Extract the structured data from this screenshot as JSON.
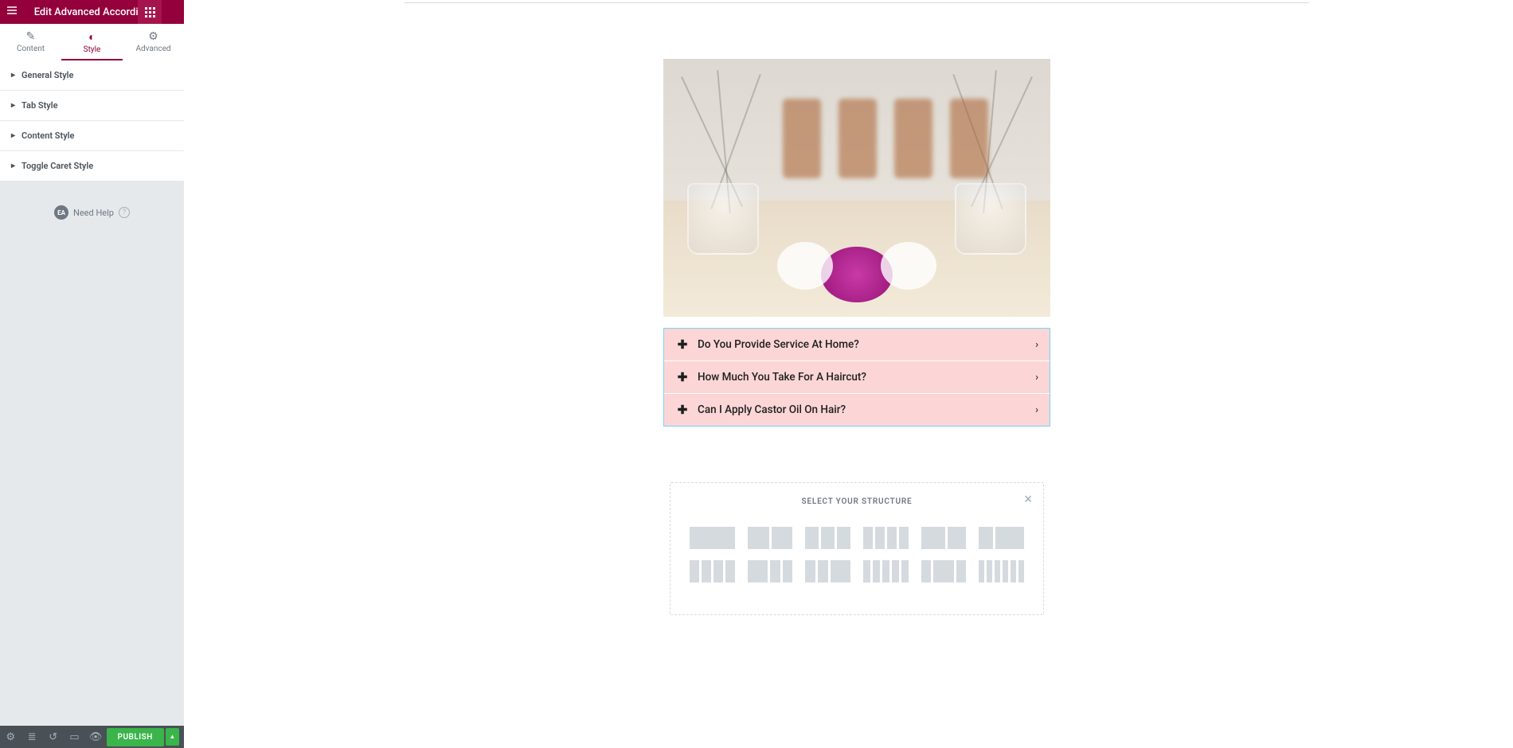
{
  "header": {
    "title": "Edit Advanced Accordion"
  },
  "tabs": [
    {
      "label": "Content"
    },
    {
      "label": "Style"
    },
    {
      "label": "Advanced"
    }
  ],
  "sections": [
    {
      "label": "General Style"
    },
    {
      "label": "Tab Style"
    },
    {
      "label": "Content Style"
    },
    {
      "label": "Toggle Caret Style"
    }
  ],
  "help": {
    "badge": "EA",
    "label": "Need Help"
  },
  "footer": {
    "publish": "PUBLISH"
  },
  "accordion": {
    "items": [
      {
        "title": "Do You Provide Service At Home?"
      },
      {
        "title": "How Much You Take For A Haircut?"
      },
      {
        "title": "Can I Apply Castor Oil On Hair?"
      }
    ]
  },
  "structure": {
    "title": "SELECT YOUR STRUCTURE"
  }
}
